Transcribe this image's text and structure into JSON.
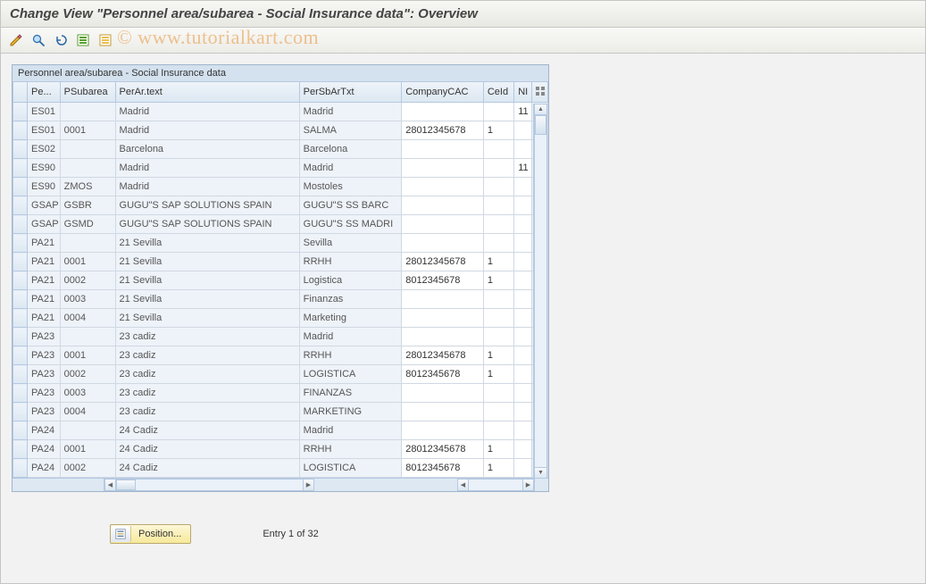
{
  "window": {
    "title": "Change View \"Personnel area/subarea - Social Insurance data\": Overview"
  },
  "watermark": "© www.tutorialkart.com",
  "panel": {
    "title": "Personnel area/subarea - Social Insurance data"
  },
  "columns": {
    "pe": "Pe...",
    "psubarea": "PSubarea",
    "perar_text": "PerAr.text",
    "persbar_txt": "PerSbArTxt",
    "company_cac": "CompanyCAC",
    "ceid": "CeId",
    "ni": "NI"
  },
  "rows": [
    {
      "pe": "ES01",
      "psub": "",
      "ptxt": "Madrid",
      "psbt": "Madrid",
      "cac": "",
      "ceid": "",
      "ni": "11"
    },
    {
      "pe": "ES01",
      "psub": "0001",
      "ptxt": "Madrid",
      "psbt": "SALMA",
      "cac": "28012345678",
      "ceid": "1",
      "ni": ""
    },
    {
      "pe": "ES02",
      "psub": "",
      "ptxt": "Barcelona",
      "psbt": "Barcelona",
      "cac": "",
      "ceid": "",
      "ni": ""
    },
    {
      "pe": "ES90",
      "psub": "",
      "ptxt": "Madrid",
      "psbt": "Madrid",
      "cac": "",
      "ceid": "",
      "ni": "11"
    },
    {
      "pe": "ES90",
      "psub": "ZMOS",
      "ptxt": "Madrid",
      "psbt": "Mostoles",
      "cac": "",
      "ceid": "",
      "ni": ""
    },
    {
      "pe": "GSAP",
      "psub": "GSBR",
      "ptxt": "GUGU\"S SAP SOLUTIONS SPAIN",
      "psbt": "GUGU\"S SS BARC",
      "cac": "",
      "ceid": "",
      "ni": ""
    },
    {
      "pe": "GSAP",
      "psub": "GSMD",
      "ptxt": "GUGU\"S SAP SOLUTIONS SPAIN",
      "psbt": "GUGU\"S SS MADRI",
      "cac": "",
      "ceid": "",
      "ni": ""
    },
    {
      "pe": "PA21",
      "psub": "",
      "ptxt": "21 Sevilla",
      "psbt": "Sevilla",
      "cac": "",
      "ceid": "",
      "ni": ""
    },
    {
      "pe": "PA21",
      "psub": "0001",
      "ptxt": "21 Sevilla",
      "psbt": "RRHH",
      "cac": "28012345678",
      "ceid": "1",
      "ni": ""
    },
    {
      "pe": "PA21",
      "psub": "0002",
      "ptxt": "21 Sevilla",
      "psbt": "Logistica",
      "cac": "8012345678",
      "ceid": "1",
      "ni": ""
    },
    {
      "pe": "PA21",
      "psub": "0003",
      "ptxt": "21 Sevilla",
      "psbt": "Finanzas",
      "cac": "",
      "ceid": "",
      "ni": ""
    },
    {
      "pe": "PA21",
      "psub": "0004",
      "ptxt": "21 Sevilla",
      "psbt": "Marketing",
      "cac": "",
      "ceid": "",
      "ni": ""
    },
    {
      "pe": "PA23",
      "psub": "",
      "ptxt": "23 cadiz",
      "psbt": "Madrid",
      "cac": "",
      "ceid": "",
      "ni": ""
    },
    {
      "pe": "PA23",
      "psub": "0001",
      "ptxt": "23 cadiz",
      "psbt": "RRHH",
      "cac": "28012345678",
      "ceid": "1",
      "ni": ""
    },
    {
      "pe": "PA23",
      "psub": "0002",
      "ptxt": "23 cadiz",
      "psbt": "LOGISTICA",
      "cac": "8012345678",
      "ceid": "1",
      "ni": ""
    },
    {
      "pe": "PA23",
      "psub": "0003",
      "ptxt": "23 cadiz",
      "psbt": "FINANZAS",
      "cac": "",
      "ceid": "",
      "ni": ""
    },
    {
      "pe": "PA23",
      "psub": "0004",
      "ptxt": "23 cadiz",
      "psbt": "MARKETING",
      "cac": "",
      "ceid": "",
      "ni": ""
    },
    {
      "pe": "PA24",
      "psub": "",
      "ptxt": "24 Cadiz",
      "psbt": "Madrid",
      "cac": "",
      "ceid": "",
      "ni": ""
    },
    {
      "pe": "PA24",
      "psub": "0001",
      "ptxt": "24 Cadiz",
      "psbt": "RRHH",
      "cac": "28012345678",
      "ceid": "1",
      "ni": ""
    },
    {
      "pe": "PA24",
      "psub": "0002",
      "ptxt": "24 Cadiz",
      "psbt": "LOGISTICA",
      "cac": "8012345678",
      "ceid": "1",
      "ni": ""
    }
  ],
  "footer": {
    "position_label": "Position...",
    "entry_text": "Entry 1 of 32"
  }
}
